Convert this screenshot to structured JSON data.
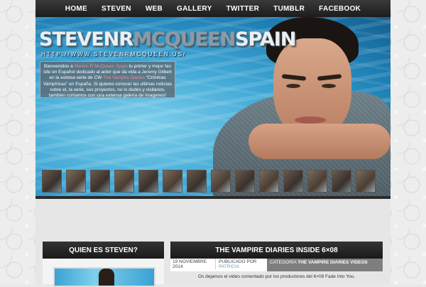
{
  "nav": [
    "HOME",
    "STEVEN",
    "WEB",
    "GALLERY",
    "TWITTER",
    "TUMBLR",
    "FACEBOOK"
  ],
  "header": {
    "logo_a": "STEVENR",
    "logo_b": "MCQUEEN",
    "logo_c": "SPAIN",
    "url": "HTTP://WWW.STEVENRMCQUEEN.US/",
    "intro_1": "Bienvenidos a ",
    "intro_site": "Steven R McQueen Spain",
    "intro_2": " tu primer y mejor fan site en Español dedicado al actor que da vida a Jeremy Gilbert en la exitosa serie de CW ",
    "intro_show": "The Vampire Diaries",
    "intro_3": " \"Crónicas Vampíricas\" en España. Si quieres conocer las ultimas noticias sobre el, la serie, sus proyectos, no lo dudes y visitanos, tambien contamos con una extensa galería de imagenes!"
  },
  "thumbnails_count": 14,
  "sidebar": {
    "title": "QUIEN ES STEVEN?"
  },
  "post": {
    "title": "THE VAMPIRE DIARIES INSIDE 6×08",
    "date": "19 NOVIEMBRE 2014",
    "published_label": "PUBLICADO POR",
    "author": "PATRICIA",
    "category_label": "CATEGORÍA",
    "category": "THE VAMPIRE DIARIES VIDEOS",
    "excerpt": "Os dejamos el video comentado por los productores del 6×08 Fade Into You."
  }
}
